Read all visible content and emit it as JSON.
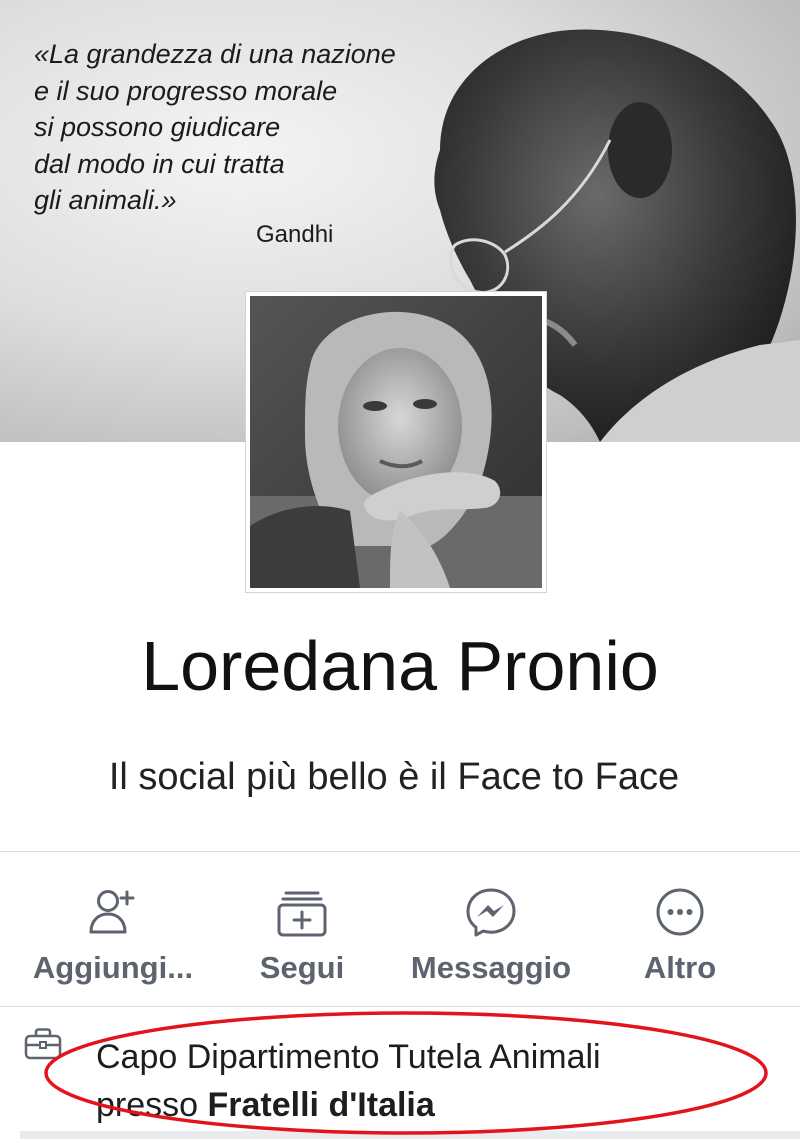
{
  "cover": {
    "quote": "«La grandezza di una nazione\ne il suo progresso morale\nsi possono giudicare\ndal modo in cui tratta\ngli animali.»",
    "author": "Gandhi"
  },
  "profile": {
    "name": "Loredana Pronio",
    "bio": "Il social più bello è il Face to Face"
  },
  "actions": [
    {
      "label": "Aggiungi...",
      "icon": "add-friend-icon"
    },
    {
      "label": "Segui",
      "icon": "follow-icon"
    },
    {
      "label": "Messaggio",
      "icon": "messenger-icon"
    },
    {
      "label": "Altro",
      "icon": "more-icon"
    }
  ],
  "work": {
    "line1": "Capo Dipartimento Tutela Animali",
    "prefix": "presso",
    "org": "Fratelli d'Italia",
    "icon": "briefcase-icon"
  },
  "colors": {
    "action_gray": "#5d6470",
    "annotation_red": "#e3131b",
    "divider": "#dcdde0"
  }
}
